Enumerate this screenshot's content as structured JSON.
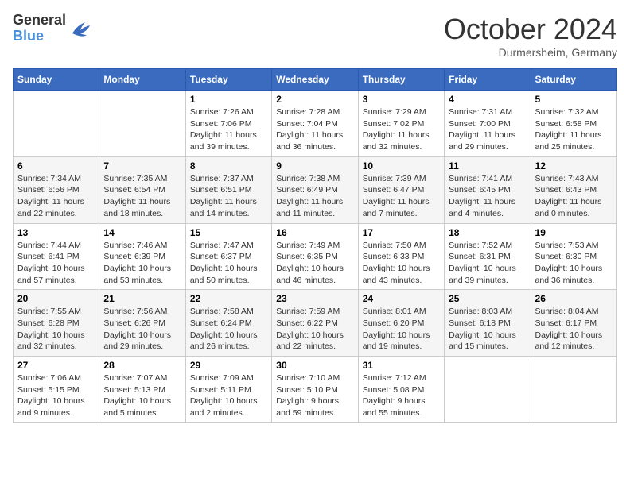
{
  "header": {
    "logo_general": "General",
    "logo_blue": "Blue",
    "month_title": "October 2024",
    "location": "Durmersheim, Germany"
  },
  "days_of_week": [
    "Sunday",
    "Monday",
    "Tuesday",
    "Wednesday",
    "Thursday",
    "Friday",
    "Saturday"
  ],
  "weeks": [
    [
      {
        "day": "",
        "sunrise": "",
        "sunset": "",
        "daylight": ""
      },
      {
        "day": "",
        "sunrise": "",
        "sunset": "",
        "daylight": ""
      },
      {
        "day": "1",
        "sunrise": "Sunrise: 7:26 AM",
        "sunset": "Sunset: 7:06 PM",
        "daylight": "Daylight: 11 hours and 39 minutes."
      },
      {
        "day": "2",
        "sunrise": "Sunrise: 7:28 AM",
        "sunset": "Sunset: 7:04 PM",
        "daylight": "Daylight: 11 hours and 36 minutes."
      },
      {
        "day": "3",
        "sunrise": "Sunrise: 7:29 AM",
        "sunset": "Sunset: 7:02 PM",
        "daylight": "Daylight: 11 hours and 32 minutes."
      },
      {
        "day": "4",
        "sunrise": "Sunrise: 7:31 AM",
        "sunset": "Sunset: 7:00 PM",
        "daylight": "Daylight: 11 hours and 29 minutes."
      },
      {
        "day": "5",
        "sunrise": "Sunrise: 7:32 AM",
        "sunset": "Sunset: 6:58 PM",
        "daylight": "Daylight: 11 hours and 25 minutes."
      }
    ],
    [
      {
        "day": "6",
        "sunrise": "Sunrise: 7:34 AM",
        "sunset": "Sunset: 6:56 PM",
        "daylight": "Daylight: 11 hours and 22 minutes."
      },
      {
        "day": "7",
        "sunrise": "Sunrise: 7:35 AM",
        "sunset": "Sunset: 6:54 PM",
        "daylight": "Daylight: 11 hours and 18 minutes."
      },
      {
        "day": "8",
        "sunrise": "Sunrise: 7:37 AM",
        "sunset": "Sunset: 6:51 PM",
        "daylight": "Daylight: 11 hours and 14 minutes."
      },
      {
        "day": "9",
        "sunrise": "Sunrise: 7:38 AM",
        "sunset": "Sunset: 6:49 PM",
        "daylight": "Daylight: 11 hours and 11 minutes."
      },
      {
        "day": "10",
        "sunrise": "Sunrise: 7:39 AM",
        "sunset": "Sunset: 6:47 PM",
        "daylight": "Daylight: 11 hours and 7 minutes."
      },
      {
        "day": "11",
        "sunrise": "Sunrise: 7:41 AM",
        "sunset": "Sunset: 6:45 PM",
        "daylight": "Daylight: 11 hours and 4 minutes."
      },
      {
        "day": "12",
        "sunrise": "Sunrise: 7:43 AM",
        "sunset": "Sunset: 6:43 PM",
        "daylight": "Daylight: 11 hours and 0 minutes."
      }
    ],
    [
      {
        "day": "13",
        "sunrise": "Sunrise: 7:44 AM",
        "sunset": "Sunset: 6:41 PM",
        "daylight": "Daylight: 10 hours and 57 minutes."
      },
      {
        "day": "14",
        "sunrise": "Sunrise: 7:46 AM",
        "sunset": "Sunset: 6:39 PM",
        "daylight": "Daylight: 10 hours and 53 minutes."
      },
      {
        "day": "15",
        "sunrise": "Sunrise: 7:47 AM",
        "sunset": "Sunset: 6:37 PM",
        "daylight": "Daylight: 10 hours and 50 minutes."
      },
      {
        "day": "16",
        "sunrise": "Sunrise: 7:49 AM",
        "sunset": "Sunset: 6:35 PM",
        "daylight": "Daylight: 10 hours and 46 minutes."
      },
      {
        "day": "17",
        "sunrise": "Sunrise: 7:50 AM",
        "sunset": "Sunset: 6:33 PM",
        "daylight": "Daylight: 10 hours and 43 minutes."
      },
      {
        "day": "18",
        "sunrise": "Sunrise: 7:52 AM",
        "sunset": "Sunset: 6:31 PM",
        "daylight": "Daylight: 10 hours and 39 minutes."
      },
      {
        "day": "19",
        "sunrise": "Sunrise: 7:53 AM",
        "sunset": "Sunset: 6:30 PM",
        "daylight": "Daylight: 10 hours and 36 minutes."
      }
    ],
    [
      {
        "day": "20",
        "sunrise": "Sunrise: 7:55 AM",
        "sunset": "Sunset: 6:28 PM",
        "daylight": "Daylight: 10 hours and 32 minutes."
      },
      {
        "day": "21",
        "sunrise": "Sunrise: 7:56 AM",
        "sunset": "Sunset: 6:26 PM",
        "daylight": "Daylight: 10 hours and 29 minutes."
      },
      {
        "day": "22",
        "sunrise": "Sunrise: 7:58 AM",
        "sunset": "Sunset: 6:24 PM",
        "daylight": "Daylight: 10 hours and 26 minutes."
      },
      {
        "day": "23",
        "sunrise": "Sunrise: 7:59 AM",
        "sunset": "Sunset: 6:22 PM",
        "daylight": "Daylight: 10 hours and 22 minutes."
      },
      {
        "day": "24",
        "sunrise": "Sunrise: 8:01 AM",
        "sunset": "Sunset: 6:20 PM",
        "daylight": "Daylight: 10 hours and 19 minutes."
      },
      {
        "day": "25",
        "sunrise": "Sunrise: 8:03 AM",
        "sunset": "Sunset: 6:18 PM",
        "daylight": "Daylight: 10 hours and 15 minutes."
      },
      {
        "day": "26",
        "sunrise": "Sunrise: 8:04 AM",
        "sunset": "Sunset: 6:17 PM",
        "daylight": "Daylight: 10 hours and 12 minutes."
      }
    ],
    [
      {
        "day": "27",
        "sunrise": "Sunrise: 7:06 AM",
        "sunset": "Sunset: 5:15 PM",
        "daylight": "Daylight: 10 hours and 9 minutes."
      },
      {
        "day": "28",
        "sunrise": "Sunrise: 7:07 AM",
        "sunset": "Sunset: 5:13 PM",
        "daylight": "Daylight: 10 hours and 5 minutes."
      },
      {
        "day": "29",
        "sunrise": "Sunrise: 7:09 AM",
        "sunset": "Sunset: 5:11 PM",
        "daylight": "Daylight: 10 hours and 2 minutes."
      },
      {
        "day": "30",
        "sunrise": "Sunrise: 7:10 AM",
        "sunset": "Sunset: 5:10 PM",
        "daylight": "Daylight: 9 hours and 59 minutes."
      },
      {
        "day": "31",
        "sunrise": "Sunrise: 7:12 AM",
        "sunset": "Sunset: 5:08 PM",
        "daylight": "Daylight: 9 hours and 55 minutes."
      },
      {
        "day": "",
        "sunrise": "",
        "sunset": "",
        "daylight": ""
      },
      {
        "day": "",
        "sunrise": "",
        "sunset": "",
        "daylight": ""
      }
    ]
  ]
}
